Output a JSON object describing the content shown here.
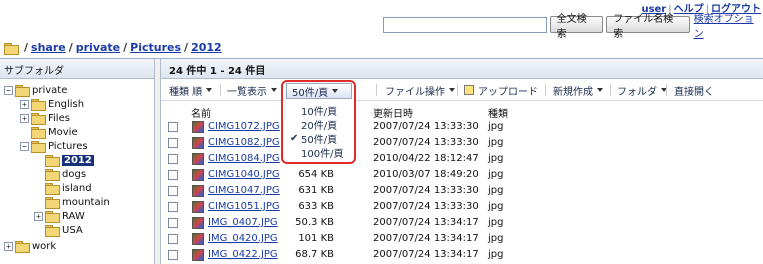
{
  "top_links": {
    "user": "user",
    "help": "ヘルプ",
    "logout": "ログアウト",
    "sep": "|"
  },
  "search": {
    "value": "",
    "fulltext_button": "全文検索",
    "filename_button": "ファイル名検索",
    "options_link": "検索オプション"
  },
  "breadcrumb": {
    "items": [
      "share",
      "private",
      "Pictures",
      "2012"
    ],
    "sep": "/"
  },
  "sidebar": {
    "title": "サブフォルダ",
    "tree": [
      {
        "label": "private",
        "expander": "−"
      },
      {
        "label": "English",
        "expander": "+"
      },
      {
        "label": "Files",
        "expander": "+"
      },
      {
        "label": "Movie",
        "expander": ""
      },
      {
        "label": "Pictures",
        "expander": "−"
      },
      {
        "label": "2012",
        "expander": "",
        "selected": true
      },
      {
        "label": "dogs",
        "expander": ""
      },
      {
        "label": "island",
        "expander": ""
      },
      {
        "label": "mountain",
        "expander": ""
      },
      {
        "label": "RAW",
        "expander": "+"
      },
      {
        "label": "USA",
        "expander": ""
      },
      {
        "label": "work",
        "expander": "+"
      }
    ]
  },
  "main": {
    "count_text": "24 件中 1 - 24 件目",
    "toolbar": {
      "sort": "種類 順",
      "view": "一覧表示",
      "per_page": "50件/頁",
      "file_ops": "ファイル操作",
      "upload": "アップロード",
      "new": "新規作成",
      "folder": "フォルダ",
      "direct_open": "直接開く"
    },
    "columns": {
      "name": "名前",
      "modified": "更新日時",
      "type": "種類"
    },
    "files": [
      {
        "name": "CIMG1072.JPG",
        "size": "",
        "date": "2007/07/24 13:33:30",
        "type": "jpg"
      },
      {
        "name": "CIMG1082.JPG",
        "size": "",
        "date": "2007/07/24 13:33:30",
        "type": "jpg"
      },
      {
        "name": "CIMG1084.JPG",
        "size": "",
        "date": "2010/04/22 18:12:47",
        "type": "jpg"
      },
      {
        "name": "CIMG1040.JPG",
        "size": "654 KB",
        "date": "2010/03/07 18:49:20",
        "type": "jpg"
      },
      {
        "name": "CIMG1047.JPG",
        "size": "631 KB",
        "date": "2007/07/24 13:33:30",
        "type": "jpg"
      },
      {
        "name": "CIMG1051.JPG",
        "size": "633 KB",
        "date": "2007/07/24 13:33:30",
        "type": "jpg"
      },
      {
        "name": "IMG_0407.JPG",
        "size": "50.3 KB",
        "date": "2007/07/24 13:34:17",
        "type": "jpg"
      },
      {
        "name": "IMG_0420.JPG",
        "size": "101 KB",
        "date": "2007/07/24 13:34:17",
        "type": "jpg"
      },
      {
        "name": "IMG_0422.JPG",
        "size": "68.7 KB",
        "date": "2007/07/24 13:34:17",
        "type": "jpg"
      }
    ]
  },
  "per_page_menu": {
    "options": [
      "10件/頁",
      "20件/頁",
      "50件/頁",
      "100件/頁"
    ],
    "selected": "50件/頁",
    "check": "✔"
  },
  "colors": {
    "accent": "#16337a",
    "link": "#1a3aa6",
    "highlight_border": "#e02b2b"
  }
}
